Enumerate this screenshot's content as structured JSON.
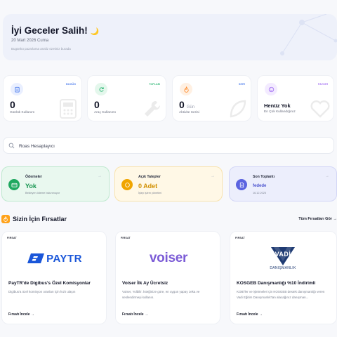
{
  "hero": {
    "greeting": "İyi Geceler Salih!",
    "emoji": "🌙",
    "date": "20 Mart 2026 Cuma",
    "subtitle": "Bugünkü pazarlama analiz özetiniz burada"
  },
  "stats": [
    {
      "tag": "BUGÜN",
      "value": "0",
      "unit": "",
      "label": "Günlük Kullanım",
      "color": "#4b7bec",
      "bg": "#e9efff",
      "icon": "clipboard-icon"
    },
    {
      "tag": "TOPLAM",
      "value": "0",
      "unit": "",
      "label": "Araç Kullanımı",
      "color": "#2bb673",
      "bg": "#e4f7ec",
      "icon": "refresh-icon"
    },
    {
      "tag": "SERİ",
      "value": "0",
      "unit": "Gün",
      "label": "Aktivite Serisi",
      "color": "#ff8a2b",
      "bg": "#fff0e2",
      "icon": "flame-icon"
    },
    {
      "tag": "FAVORİ",
      "value": "Henüz Yok",
      "unit": "",
      "label": "En Çok Kullandığınız",
      "color": "#a06cf2",
      "bg": "#f3ebff",
      "icon": "smile-icon"
    }
  ],
  "search": {
    "placeholder": "Roas Hesaplayıcı"
  },
  "quick": [
    {
      "title": "Ödemeler",
      "value": "Yok",
      "desc": "Bekleyen ödeme bulunmuyor",
      "color": "#20a860",
      "bg": "#e9f8ef",
      "border": "#bfe9cf",
      "icon": "card-icon"
    },
    {
      "title": "Açık Talepler",
      "value": "0 Adet",
      "desc": "İşlep işlem yönetimi",
      "color": "#f0a500",
      "bg": "#fff8e6",
      "border": "#f8e3ae",
      "icon": "ticket-icon"
    },
    {
      "title": "Son Toplantı",
      "value": "fedede",
      "desc": "16.12.2025",
      "color": "#5b63e0",
      "bg": "#eceefc",
      "border": "#d3d6f6",
      "icon": "document-icon"
    }
  ],
  "section": {
    "title": "Sizin İçin Fırsatlar",
    "link": "Tüm Fırsatları Gör"
  },
  "opportunities": [
    {
      "badge": "FIRSAT",
      "logo": "PAYTR",
      "title": "PayTR'de Digibus's Özel Komisyonlar",
      "desc": "Digibus'a özel komisyon oranları için hızlı ulaşın",
      "cta": "Fırsatı İncele"
    },
    {
      "badge": "FIRSAT",
      "logo": "voiser",
      "title": "Voiser İlk Ay Ücretsiz",
      "desc": "Voiser, Yolbilir. İsteğinize göre, en uygun yapay zeka ve seslendirmeyi kullanın.",
      "cta": "Fırsatı İncele"
    },
    {
      "badge": "FIRSAT",
      "logo": "VADİ",
      "logo_sub": "DANIŞMANLIK",
      "title": "KOSGEB Danışmanlığı %10 İndirimli",
      "desc": "KOBİ'ler ve işletmeler için KOSGEB destek danışmanlığı veren Vadi Eğitim Danışmanlık'tan alacağınız danışman...",
      "cta": "Fırsatı İncele"
    }
  ]
}
